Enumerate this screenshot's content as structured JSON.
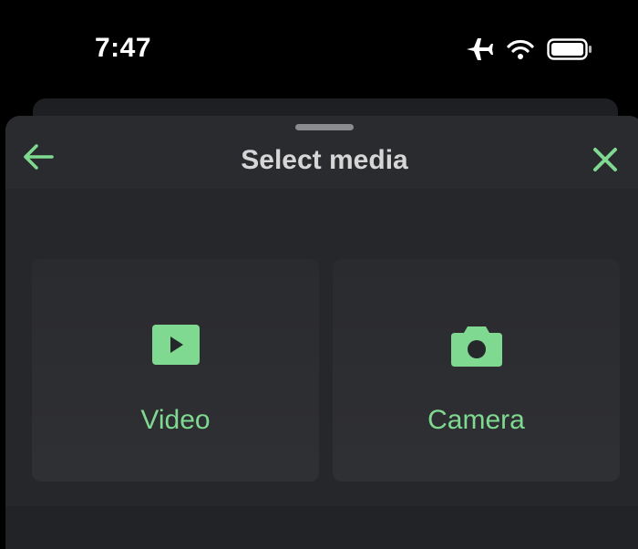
{
  "status_bar": {
    "time": "7:47",
    "icons": [
      "airplane-icon",
      "wifi-icon",
      "battery-icon"
    ]
  },
  "sheet": {
    "title": "Select media",
    "back_icon": "arrow-left-icon",
    "close_icon": "close-icon"
  },
  "options": [
    {
      "label": "Video",
      "icon": "video-play-icon"
    },
    {
      "label": "Camera",
      "icon": "camera-icon"
    }
  ],
  "colors": {
    "accent": "#7fd990",
    "sheet_background": "#26272b",
    "title_text": "#d6d6d6"
  }
}
